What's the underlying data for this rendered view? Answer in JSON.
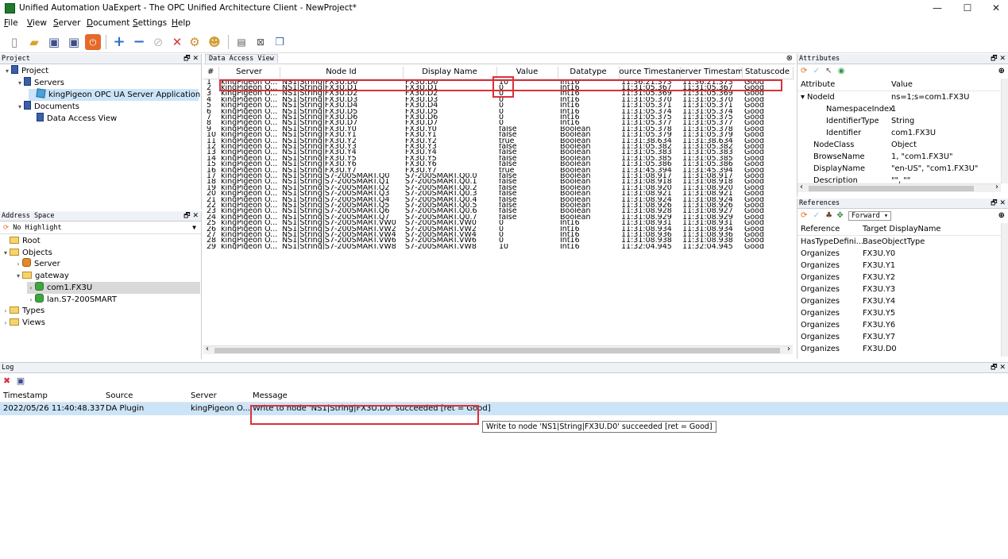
{
  "window": {
    "title": "Unified Automation UaExpert - The OPC Unified Architecture Client - NewProject*",
    "minimize": "—",
    "maximize": "☐",
    "close": "✕"
  },
  "menu": [
    "File",
    "View",
    "Server",
    "Document",
    "Settings",
    "Help"
  ],
  "menu_underline": [
    "F",
    "V",
    "S",
    "D",
    "S",
    "H"
  ],
  "toolbar": {
    "icons": [
      "new-document-icon",
      "open-folder-icon",
      "save-icon",
      "save-as-icon",
      "disconnect-icon",
      "add-server-icon",
      "remove-server-icon",
      "connect-icon",
      "disconnect-x-icon",
      "settings-icon",
      "user-icon",
      "document-icon",
      "close-document-icon",
      "window-icon"
    ]
  },
  "project_panel": {
    "title": "Project",
    "items": [
      {
        "label": "Project",
        "level": 0,
        "expanded": true,
        "icon": "project"
      },
      {
        "label": "Servers",
        "level": 1,
        "expanded": true,
        "icon": "project"
      },
      {
        "label": "kingPigeon OPC UA Server Application",
        "level": 2,
        "icon": "server"
      },
      {
        "label": "Documents",
        "level": 1,
        "expanded": true,
        "icon": "project"
      },
      {
        "label": "Data Access View",
        "level": 2,
        "icon": "project"
      }
    ]
  },
  "address_panel": {
    "title": "Address Space",
    "highlight": "No Highlight",
    "items": [
      {
        "label": "Root",
        "level": 0,
        "toggle": "",
        "icon": "folder"
      },
      {
        "label": "Objects",
        "level": 0,
        "toggle": "▾",
        "icon": "folder"
      },
      {
        "label": "Server",
        "level": 1,
        "toggle": "›",
        "icon": "orange"
      },
      {
        "label": "gateway",
        "level": 1,
        "toggle": "▾",
        "icon": "folder"
      },
      {
        "label": "com1.FX3U",
        "level": 2,
        "toggle": "›",
        "icon": "green",
        "selected": true
      },
      {
        "label": "lan.S7-200SMART",
        "level": 2,
        "toggle": "›",
        "icon": "green"
      },
      {
        "label": "Types",
        "level": 0,
        "toggle": "›",
        "icon": "folder"
      },
      {
        "label": "Views",
        "level": 0,
        "toggle": "›",
        "icon": "folder"
      }
    ]
  },
  "data_access": {
    "title": "Data Access View",
    "columns": [
      "#",
      "Server",
      "Node Id",
      "Display Name",
      "Value",
      "Datatype",
      "ource Timestam",
      "erver Timestam",
      "Statuscode"
    ],
    "rows": [
      [
        "1",
        "kingPigeon O...",
        "NS1|String|FX3U.D0",
        "FX3U.D0",
        "10",
        "Int16",
        "11:36:21.373",
        "11:36:21.373",
        "Good"
      ],
      [
        "2",
        "kingPigeon O...",
        "NS1|String|FX3U.D1",
        "FX3U.D1",
        "0",
        "Int16",
        "11:31:05.367",
        "11:31:05.367",
        "Good"
      ],
      [
        "3",
        "kingPigeon O...",
        "NS1|String|FX3U.D2",
        "FX3U.D2",
        "0",
        "Int16",
        "11:31:05.369",
        "11:31:05.369",
        "Good"
      ],
      [
        "4",
        "kingPigeon O...",
        "NS1|String|FX3U.D3",
        "FX3U.D3",
        "0",
        "Int16",
        "11:31:05.370",
        "11:31:05.370",
        "Good"
      ],
      [
        "5",
        "kingPigeon O...",
        "NS1|String|FX3U.D4",
        "FX3U.D4",
        "0",
        "Int16",
        "11:31:05.371",
        "11:31:05.371",
        "Good"
      ],
      [
        "6",
        "kingPigeon O...",
        "NS1|String|FX3U.D5",
        "FX3U.D5",
        "0",
        "Int16",
        "11:31:05.374",
        "11:31:05.374",
        "Good"
      ],
      [
        "7",
        "kingPigeon O...",
        "NS1|String|FX3U.D6",
        "FX3U.D6",
        "0",
        "Int16",
        "11:31:05.375",
        "11:31:05.375",
        "Good"
      ],
      [
        "8",
        "kingPigeon O...",
        "NS1|String|FX3U.D7",
        "FX3U.D7",
        "0",
        "Int16",
        "11:31:05.377",
        "11:31:05.377",
        "Good"
      ],
      [
        "9",
        "kingPigeon O...",
        "NS1|String|FX3U.Y0",
        "FX3U.Y0",
        "false",
        "Boolean",
        "11:31:05.378",
        "11:31:05.378",
        "Good"
      ],
      [
        "10",
        "kingPigeon O...",
        "NS1|String|FX3U.Y1",
        "FX3U.Y1",
        "false",
        "Boolean",
        "11:31:05.379",
        "11:31:05.379",
        "Good"
      ],
      [
        "11",
        "kingPigeon O...",
        "NS1|String|FX3U.Y2",
        "FX3U.Y2",
        "true",
        "Boolean",
        "11:31:38.634",
        "11:31:38.634",
        "Good"
      ],
      [
        "12",
        "kingPigeon O...",
        "NS1|String|FX3U.Y3",
        "FX3U.Y3",
        "false",
        "Boolean",
        "11:31:05.382",
        "11:31:05.382",
        "Good"
      ],
      [
        "13",
        "kingPigeon O...",
        "NS1|String|FX3U.Y4",
        "FX3U.Y4",
        "false",
        "Boolean",
        "11:31:05.383",
        "11:31:05.383",
        "Good"
      ],
      [
        "14",
        "kingPigeon O...",
        "NS1|String|FX3U.Y5",
        "FX3U.Y5",
        "false",
        "Boolean",
        "11:31:05.385",
        "11:31:05.385",
        "Good"
      ],
      [
        "15",
        "kingPigeon O...",
        "NS1|String|FX3U.Y6",
        "FX3U.Y6",
        "false",
        "Boolean",
        "11:31:05.386",
        "11:31:05.386",
        "Good"
      ],
      [
        "16",
        "kingPigeon O...",
        "NS1|String|FX3U.Y7",
        "FX3U.Y7",
        "true",
        "Boolean",
        "11:31:45.394",
        "11:31:45.394",
        "Good"
      ],
      [
        "17",
        "kingPigeon O...",
        "NS1|String|S7-200SMART.Q0",
        "S7-200SMART.Q0.0",
        "false",
        "Boolean",
        "11:31:08.917",
        "11:31:08.917",
        "Good"
      ],
      [
        "18",
        "kingPigeon O...",
        "NS1|String|S7-200SMART.Q1",
        "S7-200SMART.Q0.1",
        "false",
        "Boolean",
        "11:31:08.918",
        "11:31:08.918",
        "Good"
      ],
      [
        "19",
        "kingPigeon O...",
        "NS1|String|S7-200SMART.Q2",
        "S7-200SMART.Q0.2",
        "false",
        "Boolean",
        "11:31:08.920",
        "11:31:08.920",
        "Good"
      ],
      [
        "20",
        "kingPigeon O...",
        "NS1|String|S7-200SMART.Q3",
        "S7-200SMART.Q0.3",
        "false",
        "Boolean",
        "11:31:08.921",
        "11:31:08.921",
        "Good"
      ],
      [
        "21",
        "kingPigeon O...",
        "NS1|String|S7-200SMART.Q4",
        "S7-200SMART.Q0.4",
        "false",
        "Boolean",
        "11:31:08.924",
        "11:31:08.924",
        "Good"
      ],
      [
        "22",
        "kingPigeon O...",
        "NS1|String|S7-200SMART.Q5",
        "S7-200SMART.Q0.5",
        "false",
        "Boolean",
        "11:31:08.926",
        "11:31:08.926",
        "Good"
      ],
      [
        "23",
        "kingPigeon O...",
        "NS1|String|S7-200SMART.Q6",
        "S7-200SMART.Q0.6",
        "false",
        "Boolean",
        "11:31:08.928",
        "11:31:08.927",
        "Good"
      ],
      [
        "24",
        "kingPigeon O...",
        "NS1|String|S7-200SMART.Q7",
        "S7-200SMART.Q0.7",
        "false",
        "Boolean",
        "11:31:08.929",
        "11:31:08.929",
        "Good"
      ],
      [
        "25",
        "kingPigeon O...",
        "NS1|String|S7-200SMART.VW0",
        "S7-200SMART.VW0",
        "0",
        "Int16",
        "11:31:08.931",
        "11:31:08.931",
        "Good"
      ],
      [
        "26",
        "kingPigeon O...",
        "NS1|String|S7-200SMART.VW2",
        "S7-200SMART.VW2",
        "0",
        "Int16",
        "11:31:08.934",
        "11:31:08.934",
        "Good"
      ],
      [
        "27",
        "kingPigeon O...",
        "NS1|String|S7-200SMART.VW4",
        "S7-200SMART.VW4",
        "0",
        "Int16",
        "11:31:08.936",
        "11:31:08.936",
        "Good"
      ],
      [
        "28",
        "kingPigeon O...",
        "NS1|String|S7-200SMART.VW6",
        "S7-200SMART.VW6",
        "0",
        "Int16",
        "11:31:08.938",
        "11:31:08.938",
        "Good"
      ],
      [
        "29",
        "kingPigeon O...",
        "NS1|String|S7-200SMART.VW8",
        "S7-200SMART.VW8",
        "10",
        "Int16",
        "11:32:04.945",
        "11:32:04.945",
        "Good"
      ]
    ]
  },
  "attributes_panel": {
    "title": "Attributes",
    "col_attribute": "Attribute",
    "col_value": "Value",
    "rows": [
      {
        "name": "NodeId",
        "value": "ns=1;s=com1.FX3U",
        "indent": 0,
        "toggle": "▾"
      },
      {
        "name": "NamespaceIndex",
        "value": "1",
        "indent": 2,
        "toggle": ""
      },
      {
        "name": "IdentifierType",
        "value": "String",
        "indent": 2,
        "toggle": ""
      },
      {
        "name": "Identifier",
        "value": "com1.FX3U",
        "indent": 2,
        "toggle": ""
      },
      {
        "name": "NodeClass",
        "value": "Object",
        "indent": 1,
        "toggle": ""
      },
      {
        "name": "BrowseName",
        "value": "1, \"com1.FX3U\"",
        "indent": 1,
        "toggle": ""
      },
      {
        "name": "DisplayName",
        "value": "\"en-US\", \"com1.FX3U\"",
        "indent": 1,
        "toggle": ""
      },
      {
        "name": "Description",
        "value": "\"\", \"\"",
        "indent": 1,
        "toggle": ""
      }
    ]
  },
  "references_panel": {
    "title": "References",
    "direction": "Forward",
    "col_reference": "Reference",
    "col_target": "Target DisplayName",
    "rows": [
      [
        "HasTypeDefini...",
        "BaseObjectType"
      ],
      [
        "Organizes",
        "FX3U.Y0"
      ],
      [
        "Organizes",
        "FX3U.Y1"
      ],
      [
        "Organizes",
        "FX3U.Y2"
      ],
      [
        "Organizes",
        "FX3U.Y3"
      ],
      [
        "Organizes",
        "FX3U.Y4"
      ],
      [
        "Organizes",
        "FX3U.Y5"
      ],
      [
        "Organizes",
        "FX3U.Y6"
      ],
      [
        "Organizes",
        "FX3U.Y7"
      ],
      [
        "Organizes",
        "FX3U.D0"
      ]
    ]
  },
  "log_panel": {
    "title": "Log",
    "columns": [
      "Timestamp",
      "Source",
      "Server",
      "Message"
    ],
    "rows": [
      [
        "2022/05/26 11:40:48.337",
        "DA Plugin",
        "kingPigeon O...",
        "Write to node 'NS1|String|FX3U.D0' succeeded [ret = Good]"
      ]
    ],
    "tooltip": "Write to node 'NS1|String|FX3U.D0' succeeded [ret = Good]"
  },
  "colors": {
    "highlight_red": "#d9313a",
    "selection": "#cce4f7",
    "header_bg": "#eef2f7"
  }
}
